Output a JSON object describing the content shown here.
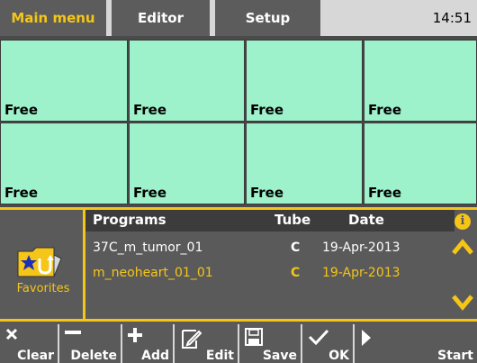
{
  "tabs": {
    "main_menu": "Main menu",
    "editor": "Editor",
    "setup": "Setup"
  },
  "clock": "14:51",
  "slots": [
    "Free",
    "Free",
    "Free",
    "Free",
    "Free",
    "Free",
    "Free",
    "Free"
  ],
  "favorites": {
    "label": "Favorites",
    "icon": "favorites-folder-icon"
  },
  "programs": {
    "headers": {
      "name": "Programs",
      "tube": "Tube",
      "date": "Date"
    },
    "rows": [
      {
        "name": "37C_m_tumor_01",
        "tube": "C",
        "date": "19-Apr-2013"
      },
      {
        "name": "m_neoheart_01_01",
        "tube": "C",
        "date": "19-Apr-2013",
        "selected": true
      }
    ]
  },
  "side_icons": {
    "info": "i",
    "up": "chevron-up-icon",
    "down": "chevron-down-icon"
  },
  "toolbar": {
    "clear": "Clear",
    "delete": "Delete",
    "add": "Add",
    "edit": "Edit",
    "save": "Save",
    "ok": "OK",
    "start": "Start"
  },
  "colors": {
    "accent": "#f5c518",
    "slot": "#9ef2cb",
    "panel": "#5a5a5a",
    "tabbar": "#d7d7d7"
  }
}
